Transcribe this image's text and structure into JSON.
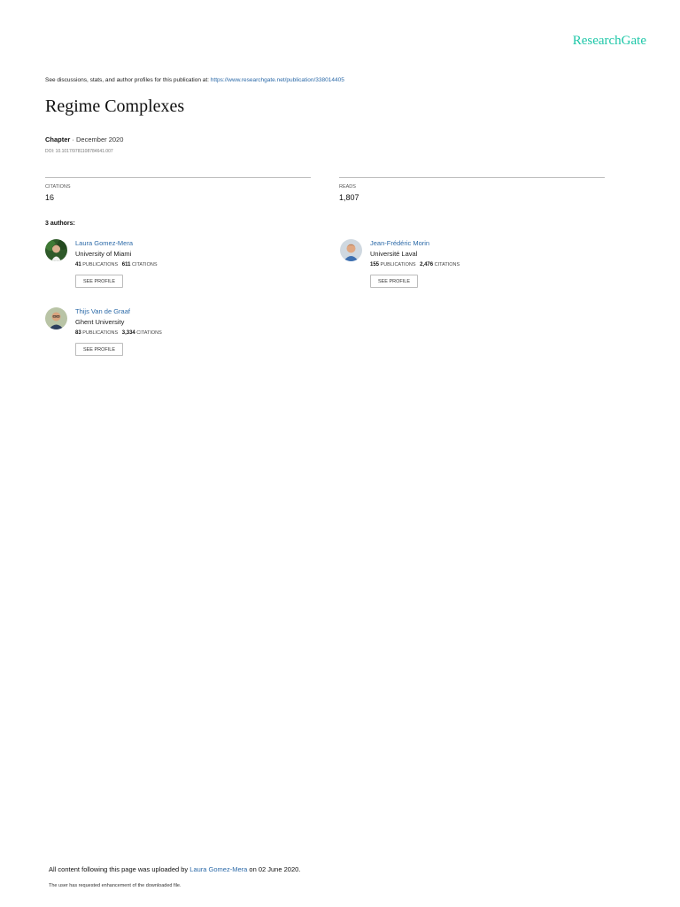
{
  "brand": "ResearchGate",
  "discussions": {
    "text": "See discussions, stats, and author profiles for this publication at: ",
    "link": "https://www.researchgate.net/publication/338014405"
  },
  "title": "Regime Complexes",
  "meta": {
    "type": "Chapter",
    "separator": " · ",
    "date": "December 2020"
  },
  "doi": "DOI: 10.1017/9781108784641.007",
  "stats": {
    "citations_label": "CITATIONS",
    "citations_value": "16",
    "reads_label": "READS",
    "reads_value": "1,807"
  },
  "authors_heading": "3 authors:",
  "authors": [
    {
      "name": "Laura Gomez-Mera",
      "institution": "University of Miami",
      "publications": "41",
      "publications_label": "PUBLICATIONS",
      "citations": "611",
      "citations_label": "CITATIONS",
      "button": "SEE PROFILE"
    },
    {
      "name": "Jean-Frédéric Morin",
      "institution": "Université Laval",
      "publications": "155",
      "publications_label": "PUBLICATIONS",
      "citations": "2,476",
      "citations_label": "CITATIONS",
      "button": "SEE PROFILE"
    },
    {
      "name": "Thijs Van de Graaf",
      "institution": "Ghent University",
      "publications": "83",
      "publications_label": "PUBLICATIONS",
      "citations": "3,334",
      "citations_label": "CITATIONS",
      "button": "SEE PROFILE"
    }
  ],
  "footer": {
    "uploaded_prefix": "All content following this page was uploaded by ",
    "uploader": "Laura Gomez-Mera",
    "uploaded_suffix": " on 02 June 2020.",
    "note": "The user has requested enhancement of the downloaded file."
  },
  "colors": {
    "brand": "#1ec7a8",
    "link": "#2c6aa8"
  }
}
